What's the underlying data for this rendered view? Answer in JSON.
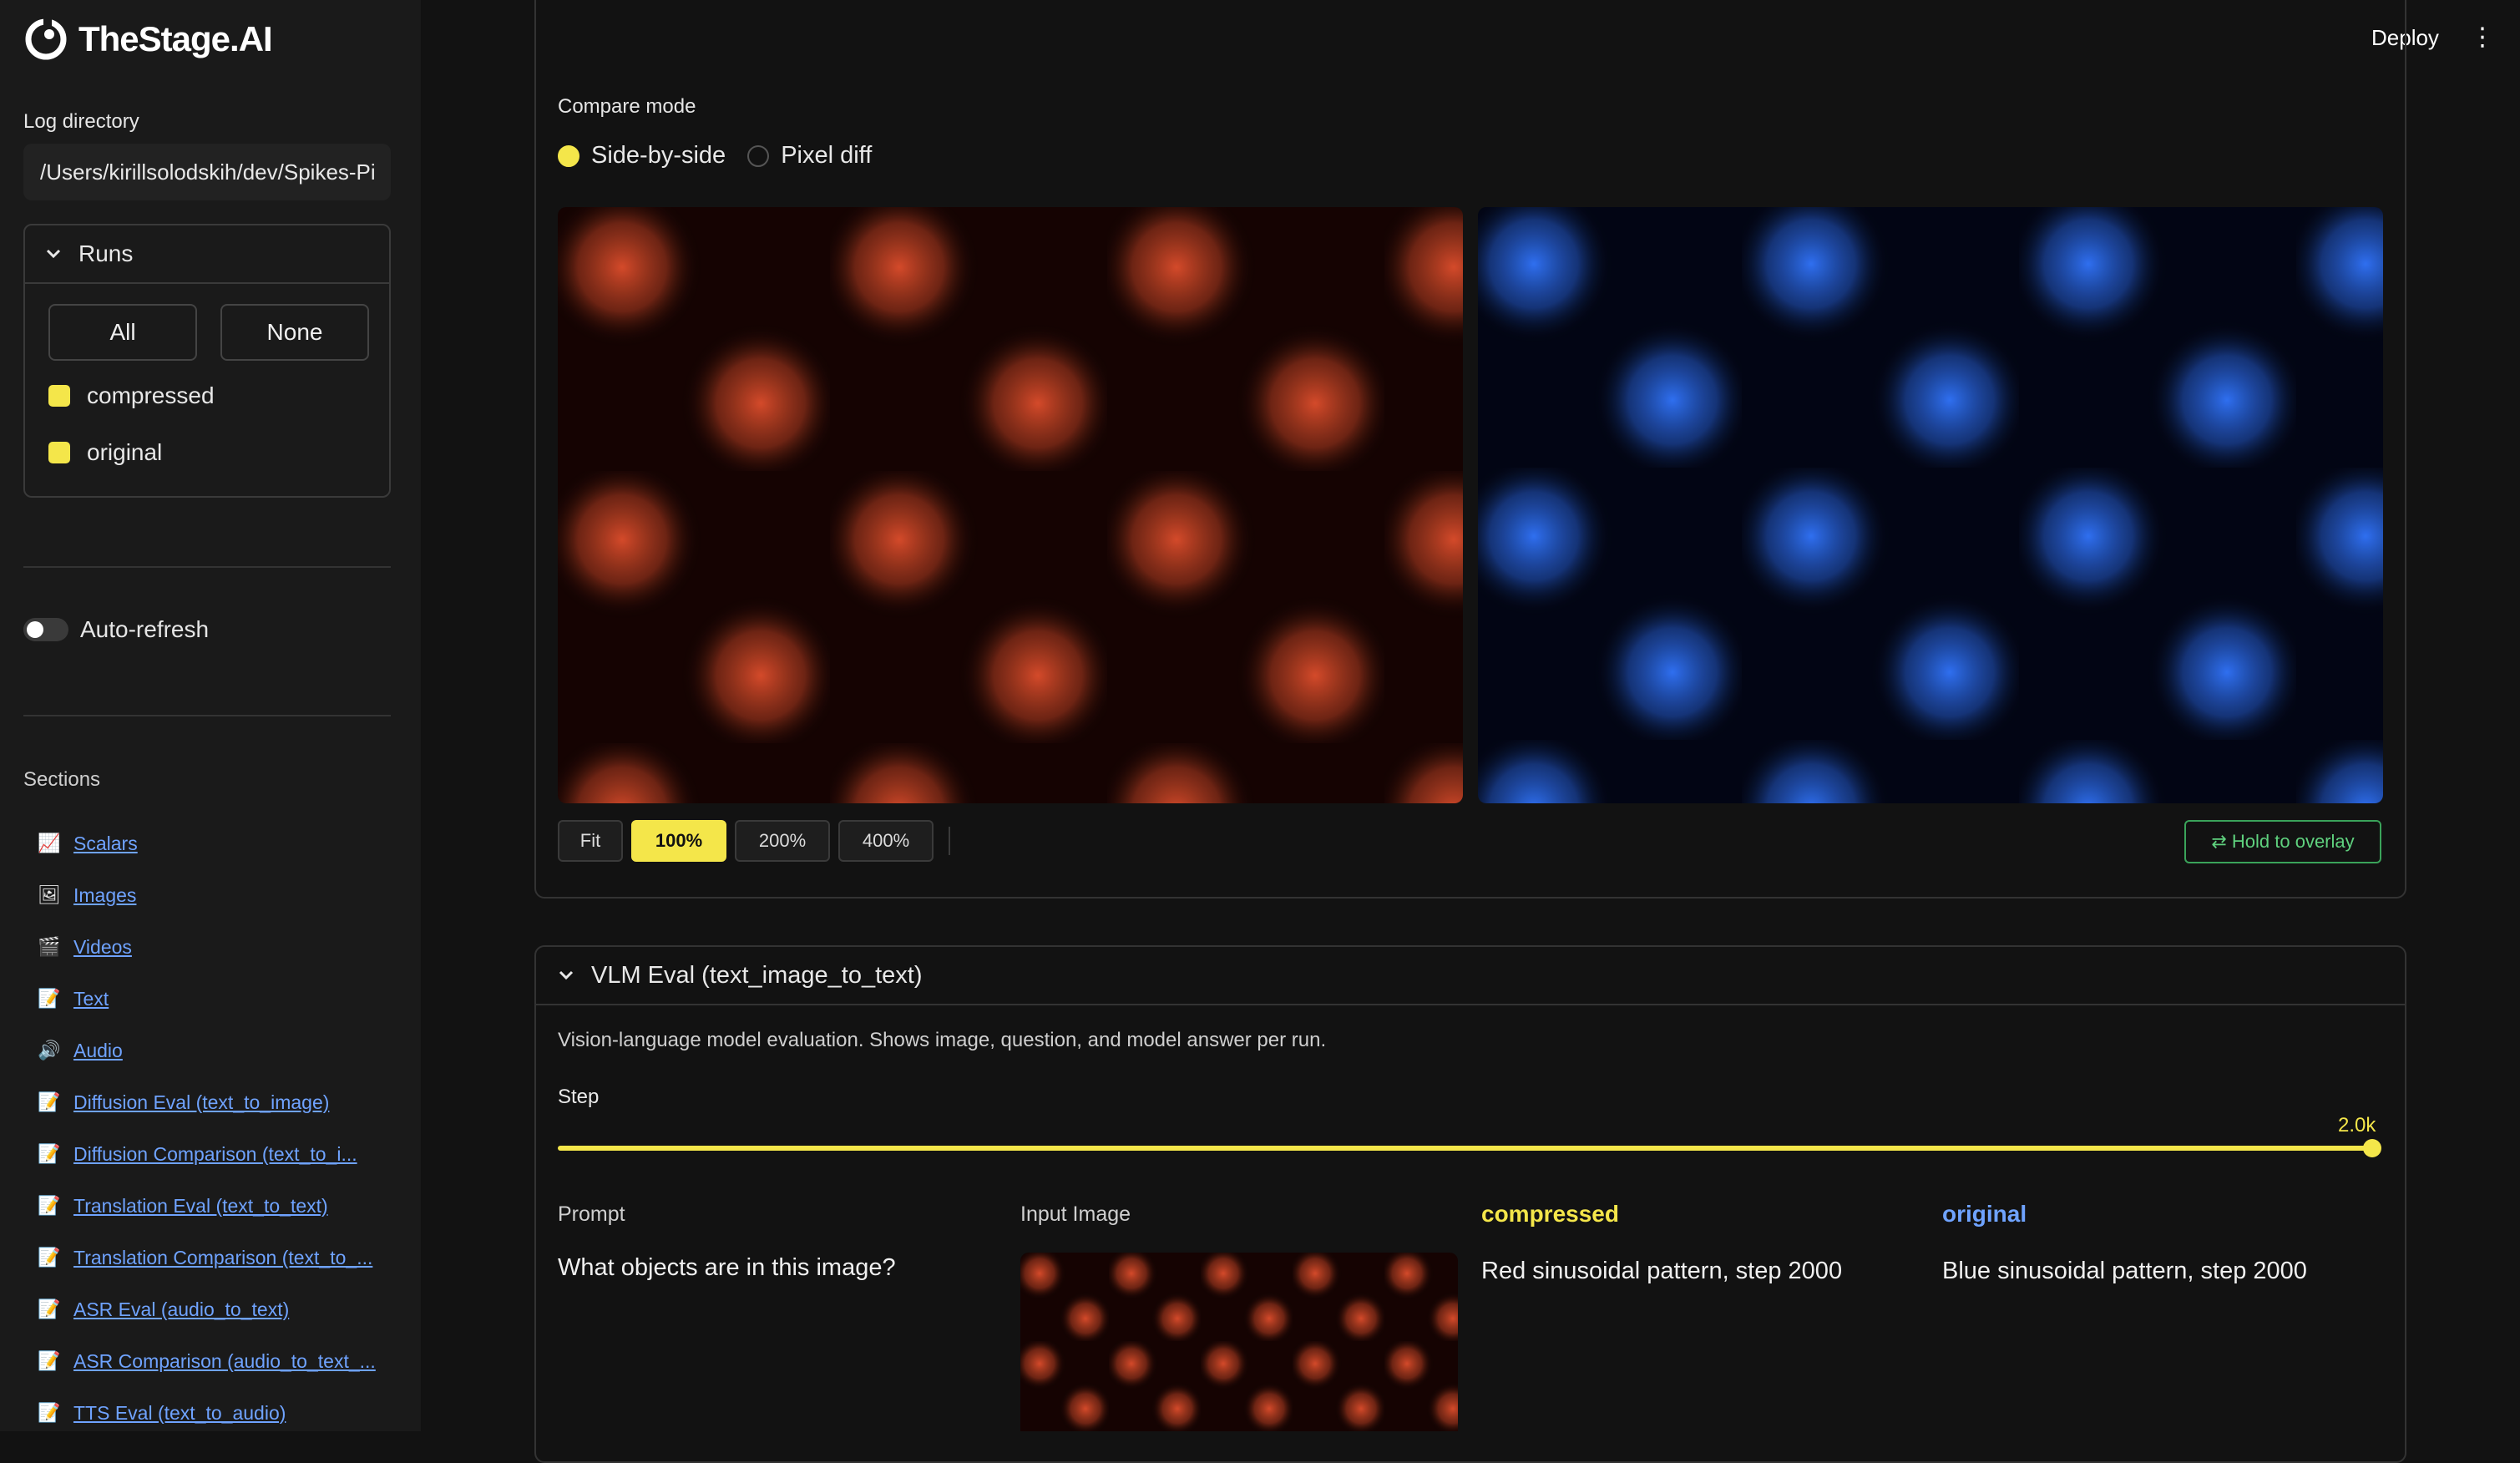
{
  "app": {
    "brand": "TheStage.AI"
  },
  "header": {
    "deploy_label": "Deploy",
    "menu_glyph": "⋮"
  },
  "sidebar": {
    "log_dir_label": "Log directory",
    "log_dir_value": "/Users/kirillsolodskih/dev/Spikes-Pi",
    "runs": {
      "title": "Runs",
      "all_label": "All",
      "none_label": "None",
      "items": [
        {
          "label": "compressed",
          "color": "#f4e64a"
        },
        {
          "label": "original",
          "color": "#f4e64a"
        }
      ]
    },
    "auto_refresh_label": "Auto-refresh",
    "sections_label": "Sections",
    "sections": [
      {
        "label": "Scalars",
        "icon": "chart-icon"
      },
      {
        "label": "Images",
        "icon": "image-icon"
      },
      {
        "label": "Videos",
        "icon": "clapper-icon"
      },
      {
        "label": "Text",
        "icon": "memo-icon"
      },
      {
        "label": "Audio",
        "icon": "speaker-icon"
      },
      {
        "label": "Diffusion Eval (text_to_image)",
        "icon": "memo-icon"
      },
      {
        "label": "Diffusion Comparison (text_to_i...",
        "icon": "memo-icon"
      },
      {
        "label": "Translation Eval (text_to_text)",
        "icon": "memo-icon"
      },
      {
        "label": "Translation Comparison (text_to_...",
        "icon": "memo-icon"
      },
      {
        "label": "ASR Eval (audio_to_text)",
        "icon": "memo-icon"
      },
      {
        "label": "ASR Comparison (audio_to_text_...",
        "icon": "memo-icon"
      },
      {
        "label": "TTS Eval (text_to_audio)",
        "icon": "memo-icon"
      }
    ]
  },
  "compare": {
    "mode_label": "Compare mode",
    "modes": [
      {
        "label": "Side-by-side",
        "selected": true
      },
      {
        "label": "Pixel diff",
        "selected": false
      }
    ],
    "zoom": [
      {
        "label": "Fit",
        "active": false
      },
      {
        "label": "100%",
        "active": true
      },
      {
        "label": "200%",
        "active": false
      },
      {
        "label": "400%",
        "active": false
      }
    ],
    "overlay_label": "⇄ Hold to overlay",
    "left_color": "#e05530",
    "right_color": "#2f6ff0"
  },
  "vlm": {
    "title": "VLM Eval (text_image_to_text)",
    "description": "Vision-language model evaluation. Shows image, question, and model answer per run.",
    "step_label": "Step",
    "step_value": "2.0k",
    "step_fraction": 1.0,
    "columns": {
      "prompt": "Prompt",
      "input_image": "Input Image",
      "compressed": "compressed",
      "original": "original"
    },
    "compressed_color": "#f4e64a",
    "original_color": "#6fa3ff",
    "prompt_text": "What objects are in this image?",
    "compressed_answer": "Red sinusoidal pattern, step 2000",
    "original_answer": "Blue sinusoidal pattern, step 2000"
  }
}
